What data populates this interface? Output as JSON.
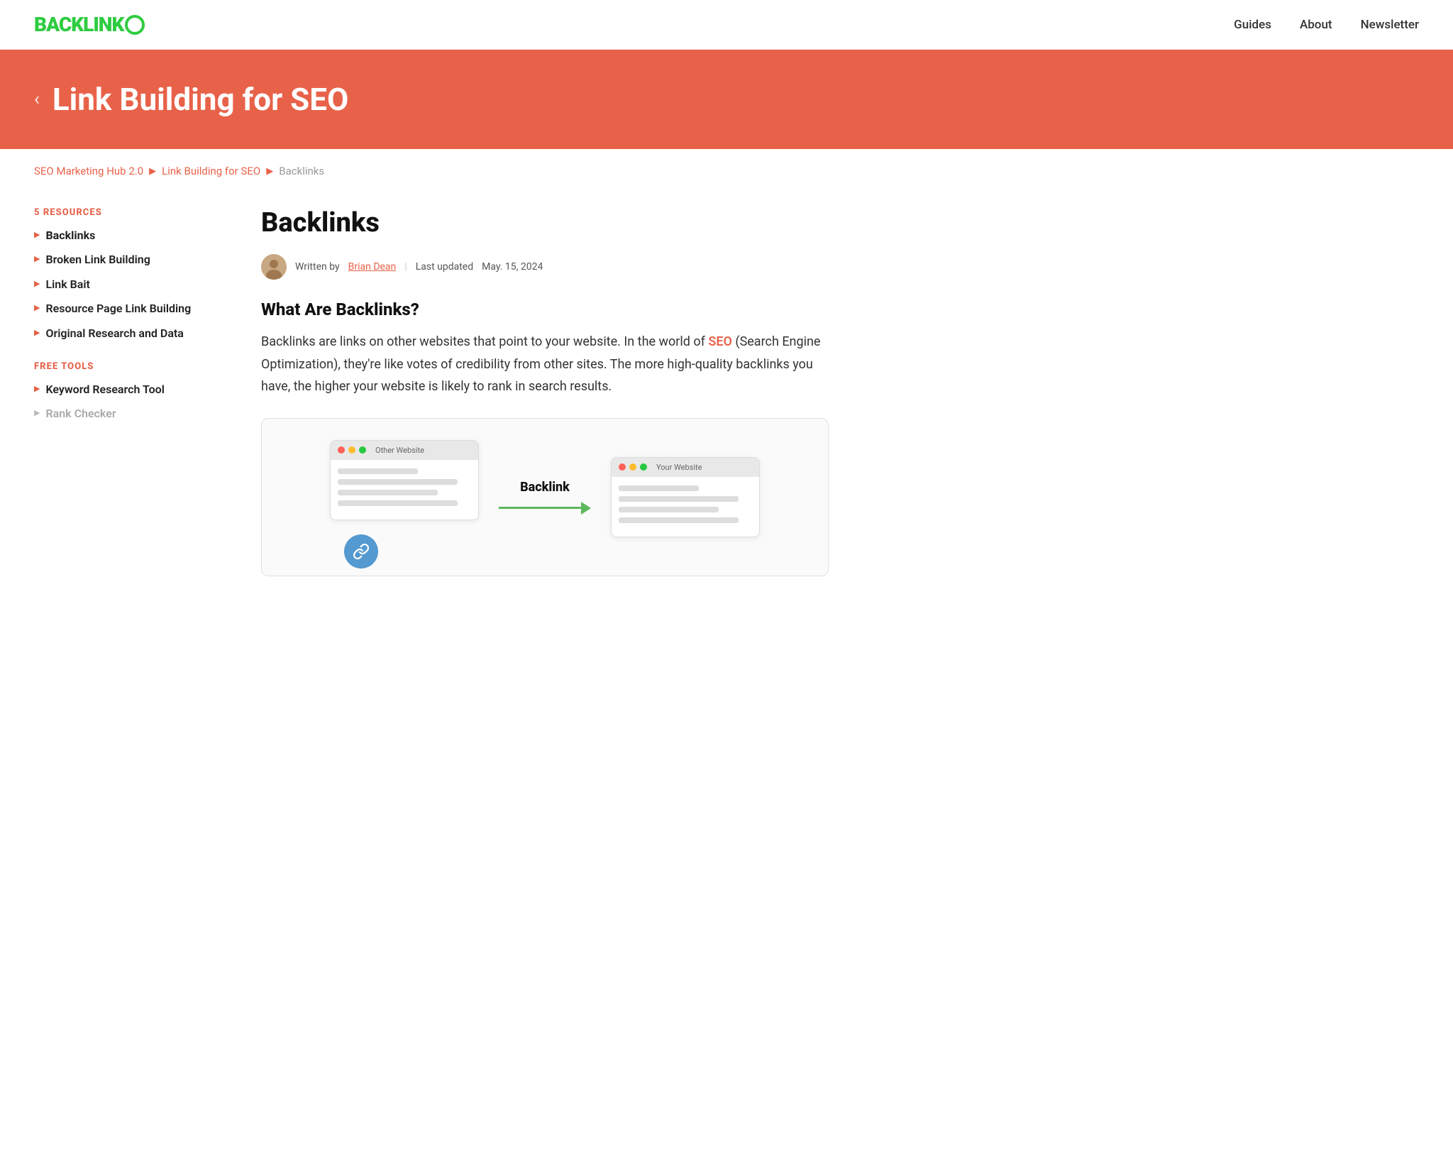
{
  "header": {
    "logo_text": "BACKLINK",
    "nav_items": [
      {
        "label": "Guides",
        "href": "#"
      },
      {
        "label": "About",
        "href": "#"
      },
      {
        "label": "Newsletter",
        "href": "#"
      }
    ]
  },
  "hero": {
    "back_icon": "‹",
    "title": "Link Building for SEO"
  },
  "breadcrumb": {
    "items": [
      {
        "label": "SEO Marketing Hub 2.0",
        "active": true
      },
      {
        "label": "Link Building for SEO",
        "active": true
      },
      {
        "label": "Backlinks",
        "active": false
      }
    ]
  },
  "sidebar": {
    "resources_heading": "5 RESOURCES",
    "resources": [
      {
        "label": "Backlinks",
        "active": true
      },
      {
        "label": "Broken Link Building",
        "active": false
      },
      {
        "label": "Link Bait",
        "active": false
      },
      {
        "label": "Resource Page Link Building",
        "active": false
      },
      {
        "label": "Original Research and Data",
        "active": false
      }
    ],
    "tools_heading": "FREE TOOLS",
    "tools": [
      {
        "label": "Keyword Research Tool",
        "active": false
      },
      {
        "label": "Rank Checker",
        "active": false,
        "muted": true
      }
    ]
  },
  "content": {
    "title": "Backlinks",
    "author_prefix": "Written by ",
    "author_name": "Brian Dean",
    "date_prefix": "Last updated ",
    "date": "May. 15, 2024",
    "section_heading": "What Are Backlinks?",
    "body_paragraph": "Backlinks are links on other websites that point to your website. In the world of SEO (Search Engine Optimization), they're like votes of credibility from other sites. The more high-quality backlinks you have, the higher your website is likely to rank in search results.",
    "seo_word": "SEO",
    "diagram": {
      "left_label": "Other Website",
      "right_label": "Your Website",
      "arrow_label": "Backlink"
    }
  }
}
